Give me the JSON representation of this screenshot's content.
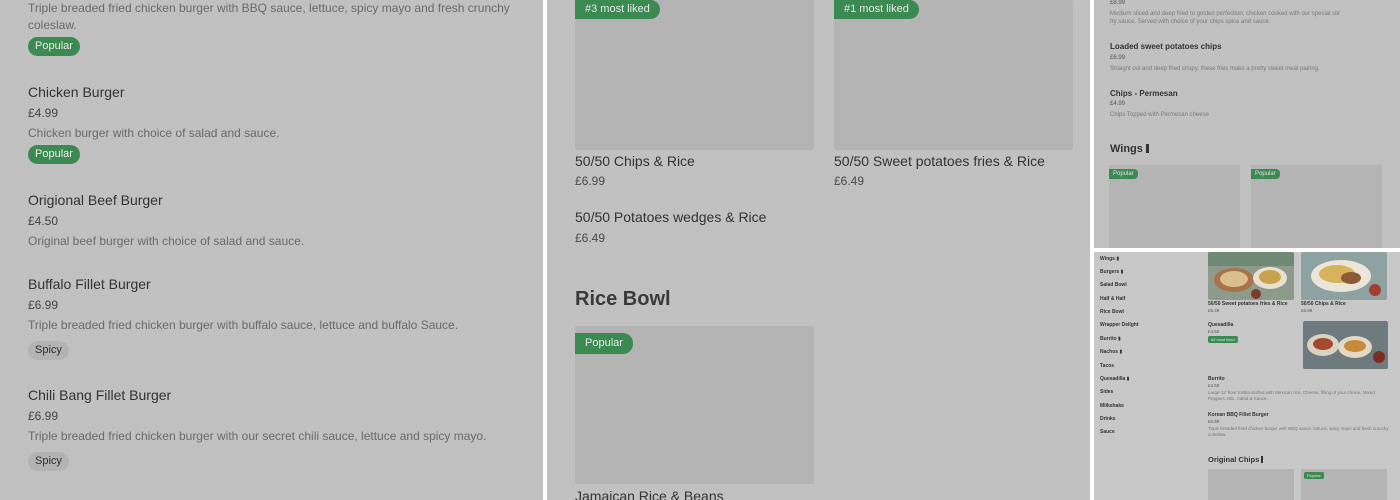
{
  "panel1": {
    "top_desc": "Triple breaded fried chicken burger with BBQ sauce, lettuce, spicy mayo and fresh crunchy coleslaw.",
    "top_badge": "Popular",
    "items": [
      {
        "title": "Chicken Burger",
        "price": "£4.99",
        "desc": "Chicken burger with choice of salad and sauce.",
        "badge": "Popular"
      },
      {
        "title": "Origional Beef Burger",
        "price": "£4.50",
        "desc": "Original beef burger with choice of salad and sauce."
      },
      {
        "title": "Buffalo Fillet Burger",
        "price": "£6.99",
        "desc": "Triple breaded fried chicken burger with buffalo sauce, lettuce and buffalo Sauce.",
        "badge": "Spicy"
      },
      {
        "title": "Chili Bang Fillet Burger",
        "price": "£6.99",
        "desc": "Triple breaded fried chicken burger with our secret chili sauce, lettuce and spicy mayo.",
        "badge": "Spicy"
      }
    ]
  },
  "panel2": {
    "cards": [
      {
        "badge": "#3 most liked",
        "title": "50/50 Chips & Rice",
        "price": "£6.99"
      },
      {
        "badge": "#1 most liked",
        "title": "50/50 Sweet potatoes fries & Rice",
        "price": "£6.49"
      }
    ],
    "wedges": {
      "title": "50/50 Potatoes wedges & Rice",
      "price": "£6.49"
    },
    "section_title": "Rice Bowl",
    "rice_card": {
      "badge": "Popular",
      "title": "Jamaican Rice & Beans"
    }
  },
  "panel3": {
    "top_price": "£8.99",
    "top_desc": "Medium sliced and deep fried to golden perfection, chicken cooked with our special stir fry sauce, Served with choice of your chips spice and sauce.",
    "items": [
      {
        "title": "Loaded sweet potatoes chips",
        "price": "£6.99",
        "desc": "Straight cut and deep fried crispy, these fries make a pretty sweet meal pairing."
      },
      {
        "title": "Chips - Permesan",
        "price": "£4.99",
        "desc": "Chips Topped with Permesan cheese"
      }
    ],
    "section_title": "Wings",
    "card_badges": [
      "Popular",
      "Popular"
    ]
  },
  "panel4": {
    "nav": [
      "Wings",
      "Burgers",
      "Salad Bowl",
      "Half & Half",
      "Rice Bowl",
      "Wrapper Delight",
      "Burrito",
      "Nachos",
      "Tacos",
      "Quesadilla",
      "Sides",
      "Milkshake",
      "Drinks",
      "Sauce"
    ],
    "cards": [
      {
        "title": "50/50 Sweet potatoes fries & Rice",
        "price": "£6.49"
      },
      {
        "title": "50/50 Chips & Rice",
        "price": "£6.99"
      }
    ],
    "quesadilla": {
      "title": "Quesadilla",
      "price": "£4.50",
      "badge": "#2 most liked"
    },
    "burrito": {
      "title": "Burrito",
      "price": "£4.50",
      "desc": "Large 12' flour tortilla stuffed with Mexican rice, Cheese, filling of your choice, Mixed Peppers, Mix, Salad & Sauce."
    },
    "korean": {
      "title": "Korean BBQ Fillet Burger",
      "price": "£6.99",
      "desc": "Triple breaded fried chicken burger with BBQ sauce, lettuce, spicy mayo and fresh crunchy coleslaw."
    },
    "section_title": "Original Chips",
    "bottom_badge": "Popular"
  },
  "colors": {
    "overlay": "#c1c1c1",
    "accent": "#3b8a52",
    "card": "#b4b4b4"
  }
}
